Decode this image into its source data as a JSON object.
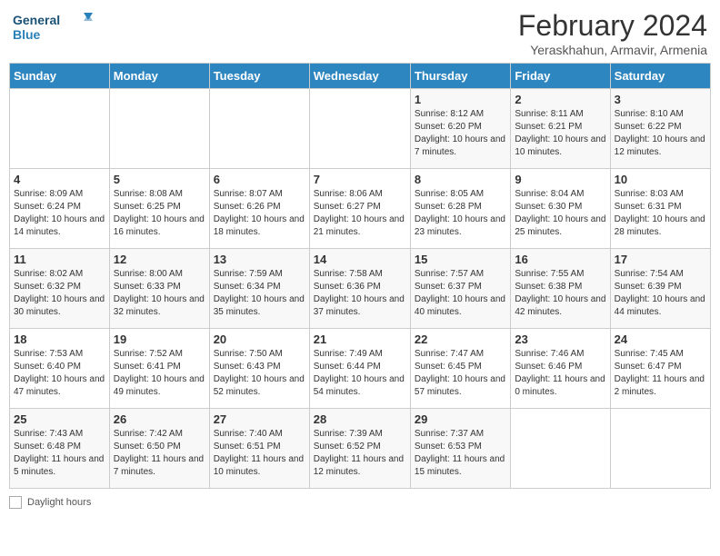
{
  "header": {
    "logo_general": "General",
    "logo_blue": "Blue",
    "title": "February 2024",
    "subtitle": "Yeraskhahun, Armavir, Armenia"
  },
  "days_of_week": [
    "Sunday",
    "Monday",
    "Tuesday",
    "Wednesday",
    "Thursday",
    "Friday",
    "Saturday"
  ],
  "weeks": [
    [
      {
        "day": "",
        "info": ""
      },
      {
        "day": "",
        "info": ""
      },
      {
        "day": "",
        "info": ""
      },
      {
        "day": "",
        "info": ""
      },
      {
        "day": "1",
        "info": "Sunrise: 8:12 AM\nSunset: 6:20 PM\nDaylight: 10 hours\nand 7 minutes."
      },
      {
        "day": "2",
        "info": "Sunrise: 8:11 AM\nSunset: 6:21 PM\nDaylight: 10 hours\nand 10 minutes."
      },
      {
        "day": "3",
        "info": "Sunrise: 8:10 AM\nSunset: 6:22 PM\nDaylight: 10 hours\nand 12 minutes."
      }
    ],
    [
      {
        "day": "4",
        "info": "Sunrise: 8:09 AM\nSunset: 6:24 PM\nDaylight: 10 hours\nand 14 minutes."
      },
      {
        "day": "5",
        "info": "Sunrise: 8:08 AM\nSunset: 6:25 PM\nDaylight: 10 hours\nand 16 minutes."
      },
      {
        "day": "6",
        "info": "Sunrise: 8:07 AM\nSunset: 6:26 PM\nDaylight: 10 hours\nand 18 minutes."
      },
      {
        "day": "7",
        "info": "Sunrise: 8:06 AM\nSunset: 6:27 PM\nDaylight: 10 hours\nand 21 minutes."
      },
      {
        "day": "8",
        "info": "Sunrise: 8:05 AM\nSunset: 6:28 PM\nDaylight: 10 hours\nand 23 minutes."
      },
      {
        "day": "9",
        "info": "Sunrise: 8:04 AM\nSunset: 6:30 PM\nDaylight: 10 hours\nand 25 minutes."
      },
      {
        "day": "10",
        "info": "Sunrise: 8:03 AM\nSunset: 6:31 PM\nDaylight: 10 hours\nand 28 minutes."
      }
    ],
    [
      {
        "day": "11",
        "info": "Sunrise: 8:02 AM\nSunset: 6:32 PM\nDaylight: 10 hours\nand 30 minutes."
      },
      {
        "day": "12",
        "info": "Sunrise: 8:00 AM\nSunset: 6:33 PM\nDaylight: 10 hours\nand 32 minutes."
      },
      {
        "day": "13",
        "info": "Sunrise: 7:59 AM\nSunset: 6:34 PM\nDaylight: 10 hours\nand 35 minutes."
      },
      {
        "day": "14",
        "info": "Sunrise: 7:58 AM\nSunset: 6:36 PM\nDaylight: 10 hours\nand 37 minutes."
      },
      {
        "day": "15",
        "info": "Sunrise: 7:57 AM\nSunset: 6:37 PM\nDaylight: 10 hours\nand 40 minutes."
      },
      {
        "day": "16",
        "info": "Sunrise: 7:55 AM\nSunset: 6:38 PM\nDaylight: 10 hours\nand 42 minutes."
      },
      {
        "day": "17",
        "info": "Sunrise: 7:54 AM\nSunset: 6:39 PM\nDaylight: 10 hours\nand 44 minutes."
      }
    ],
    [
      {
        "day": "18",
        "info": "Sunrise: 7:53 AM\nSunset: 6:40 PM\nDaylight: 10 hours\nand 47 minutes."
      },
      {
        "day": "19",
        "info": "Sunrise: 7:52 AM\nSunset: 6:41 PM\nDaylight: 10 hours\nand 49 minutes."
      },
      {
        "day": "20",
        "info": "Sunrise: 7:50 AM\nSunset: 6:43 PM\nDaylight: 10 hours\nand 52 minutes."
      },
      {
        "day": "21",
        "info": "Sunrise: 7:49 AM\nSunset: 6:44 PM\nDaylight: 10 hours\nand 54 minutes."
      },
      {
        "day": "22",
        "info": "Sunrise: 7:47 AM\nSunset: 6:45 PM\nDaylight: 10 hours\nand 57 minutes."
      },
      {
        "day": "23",
        "info": "Sunrise: 7:46 AM\nSunset: 6:46 PM\nDaylight: 11 hours\nand 0 minutes."
      },
      {
        "day": "24",
        "info": "Sunrise: 7:45 AM\nSunset: 6:47 PM\nDaylight: 11 hours\nand 2 minutes."
      }
    ],
    [
      {
        "day": "25",
        "info": "Sunrise: 7:43 AM\nSunset: 6:48 PM\nDaylight: 11 hours\nand 5 minutes."
      },
      {
        "day": "26",
        "info": "Sunrise: 7:42 AM\nSunset: 6:50 PM\nDaylight: 11 hours\nand 7 minutes."
      },
      {
        "day": "27",
        "info": "Sunrise: 7:40 AM\nSunset: 6:51 PM\nDaylight: 11 hours\nand 10 minutes."
      },
      {
        "day": "28",
        "info": "Sunrise: 7:39 AM\nSunset: 6:52 PM\nDaylight: 11 hours\nand 12 minutes."
      },
      {
        "day": "29",
        "info": "Sunrise: 7:37 AM\nSunset: 6:53 PM\nDaylight: 11 hours\nand 15 minutes."
      },
      {
        "day": "",
        "info": ""
      },
      {
        "day": "",
        "info": ""
      }
    ]
  ],
  "footer": {
    "legend_label": "Daylight hours"
  }
}
